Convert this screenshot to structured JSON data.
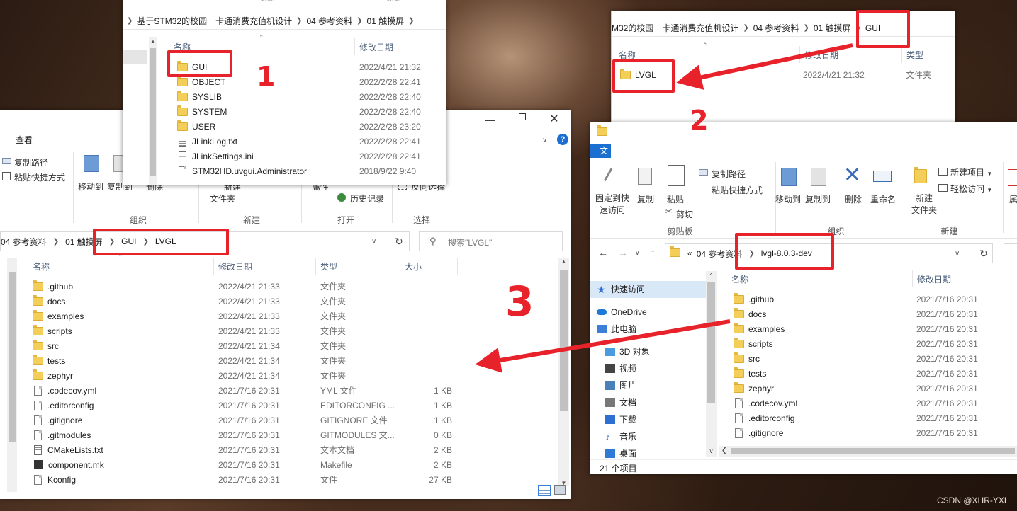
{
  "watermark": "CSDN @XHR-YXL",
  "annotations": {
    "n1": "1",
    "n2": "2",
    "n3": "3"
  },
  "win_gui_parent": {
    "breadcrumb": [
      "基于STM32的校园一卡通消费充值机设计",
      "04 参考资料",
      "01 触摸屏"
    ],
    "top_partial": [
      "还原",
      "新建"
    ],
    "col_name": "名称",
    "col_date": "修改日期",
    "rows": [
      {
        "name": "GUI",
        "date": "2022/4/21 21:32",
        "icon": "folder-icon"
      },
      {
        "name": "OBJECT",
        "date": "2022/2/28 22:41",
        "icon": "folder-icon"
      },
      {
        "name": "SYSLIB",
        "date": "2022/2/28 22:40",
        "icon": "folder-icon"
      },
      {
        "name": "SYSTEM",
        "date": "2022/2/28 22:40",
        "icon": "folder-icon"
      },
      {
        "name": "USER",
        "date": "2022/2/28 23:20",
        "icon": "folder-icon"
      },
      {
        "name": "JLinkLog.txt",
        "date": "2022/2/28 22:41",
        "icon": "txt-icon"
      },
      {
        "name": "JLinkSettings.ini",
        "date": "2022/2/28 22:41",
        "icon": "ini-icon"
      },
      {
        "name": "STM32HD.uvgui.Administrator",
        "date": "2018/9/22 9:40",
        "icon": "file-icon"
      }
    ]
  },
  "win_gui": {
    "breadcrumb": [
      "M32的校园一卡通消费充值机设计",
      "04 参考资料",
      "01 触摸屏",
      "GUI"
    ],
    "col_name": "名称",
    "col_date": "修改日期",
    "col_type": "类型",
    "rows": [
      {
        "name": "LVGL",
        "date": "2022/4/21 21:32",
        "type": "文件夹"
      }
    ]
  },
  "win_lvgl": {
    "tab_view": "查看",
    "ribbon": {
      "copy_path": "复制路径",
      "paste_shortcut": "粘贴快捷方式",
      "move_to": "移动到",
      "copy_to": "复制到",
      "delete": "删除",
      "new_item_partial": "新建",
      "file_folder": "文件夹",
      "properties": "属性",
      "history": "历史记录",
      "invert_select": "反向选择",
      "grp_organize": "组织",
      "grp_new": "新建",
      "grp_open": "打开",
      "grp_select": "选择"
    },
    "breadcrumb": [
      "04 参考资料",
      "01 触摸屏",
      "GUI",
      "LVGL"
    ],
    "search_placeholder": "搜索\"LVGL\"",
    "col_name": "名称",
    "col_date": "修改日期",
    "col_type": "类型",
    "col_size": "大小",
    "rows": [
      {
        "name": ".github",
        "date": "2022/4/21 21:33",
        "type": "文件夹",
        "size": "",
        "icon": "folder-icon"
      },
      {
        "name": "docs",
        "date": "2022/4/21 21:33",
        "type": "文件夹",
        "size": "",
        "icon": "folder-icon"
      },
      {
        "name": "examples",
        "date": "2022/4/21 21:33",
        "type": "文件夹",
        "size": "",
        "icon": "folder-icon"
      },
      {
        "name": "scripts",
        "date": "2022/4/21 21:33",
        "type": "文件夹",
        "size": "",
        "icon": "folder-icon"
      },
      {
        "name": "src",
        "date": "2022/4/21 21:34",
        "type": "文件夹",
        "size": "",
        "icon": "folder-icon"
      },
      {
        "name": "tests",
        "date": "2022/4/21 21:34",
        "type": "文件夹",
        "size": "",
        "icon": "folder-icon"
      },
      {
        "name": "zephyr",
        "date": "2022/4/21 21:34",
        "type": "文件夹",
        "size": "",
        "icon": "folder-icon"
      },
      {
        "name": ".codecov.yml",
        "date": "2021/7/16 20:31",
        "type": "YML 文件",
        "size": "1 KB",
        "icon": "file-icon"
      },
      {
        "name": ".editorconfig",
        "date": "2021/7/16 20:31",
        "type": "EDITORCONFIG ...",
        "size": "1 KB",
        "icon": "file-icon"
      },
      {
        "name": ".gitignore",
        "date": "2021/7/16 20:31",
        "type": "GITIGNORE 文件",
        "size": "1 KB",
        "icon": "file-icon"
      },
      {
        "name": ".gitmodules",
        "date": "2021/7/16 20:31",
        "type": "GITMODULES 文...",
        "size": "0 KB",
        "icon": "file-icon"
      },
      {
        "name": "CMakeLists.txt",
        "date": "2021/7/16 20:31",
        "type": "文本文档",
        "size": "2 KB",
        "icon": "txt-icon"
      },
      {
        "name": "component.mk",
        "date": "2021/7/16 20:31",
        "type": "Makefile",
        "size": "2 KB",
        "icon": "mk-icon"
      },
      {
        "name": "Kconfig",
        "date": "2021/7/16 20:31",
        "type": "文件",
        "size": "27 KB",
        "icon": "file-icon"
      }
    ]
  },
  "win_src": {
    "tab_partial": "文",
    "ribbon": {
      "pin_quick": "固定到快\n速访问",
      "copy": "复制",
      "paste": "粘贴",
      "copy_path": "复制路径",
      "paste_shortcut": "粘贴快捷方式",
      "cut": "剪切",
      "move_to": "移动到",
      "copy_to": "复制到",
      "delete": "删除",
      "rename": "重命名",
      "new_folder": "新建\n文件夹",
      "new_item": "新建项目",
      "easy_access": "轻松访问",
      "grp_clipboard": "剪贴板",
      "grp_organize": "组织",
      "grp_new": "新建",
      "attr_partial": "属"
    },
    "breadcrumb": [
      "«",
      "04 参考资料",
      "lvgl-8.0.3-dev"
    ],
    "nav": [
      {
        "label": "快速访问",
        "icon": "star-icon"
      },
      {
        "label": "OneDrive",
        "icon": "cloud-icon"
      },
      {
        "label": "此电脑",
        "icon": "pc-icon"
      },
      {
        "label": "3D 对象",
        "icon": "cube-icon"
      },
      {
        "label": "视频",
        "icon": "video-icon"
      },
      {
        "label": "图片",
        "icon": "picture-icon"
      },
      {
        "label": "文档",
        "icon": "document-icon"
      },
      {
        "label": "下载",
        "icon": "download-icon"
      },
      {
        "label": "音乐",
        "icon": "music-icon"
      },
      {
        "label": "桌面",
        "icon": "desktop-icon"
      }
    ],
    "col_name": "名称",
    "col_date": "修改日期",
    "rows": [
      {
        "name": ".github",
        "date": "2021/7/16 20:31",
        "icon": "folder-icon"
      },
      {
        "name": "docs",
        "date": "2021/7/16 20:31",
        "icon": "folder-icon"
      },
      {
        "name": "examples",
        "date": "2021/7/16 20:31",
        "icon": "folder-icon"
      },
      {
        "name": "scripts",
        "date": "2021/7/16 20:31",
        "icon": "folder-icon"
      },
      {
        "name": "src",
        "date": "2021/7/16 20:31",
        "icon": "folder-icon"
      },
      {
        "name": "tests",
        "date": "2021/7/16 20:31",
        "icon": "folder-icon"
      },
      {
        "name": "zephyr",
        "date": "2021/7/16 20:31",
        "icon": "folder-icon"
      },
      {
        "name": ".codecov.yml",
        "date": "2021/7/16 20:31",
        "icon": "file-icon"
      },
      {
        "name": ".editorconfig",
        "date": "2021/7/16 20:31",
        "icon": "file-icon"
      },
      {
        "name": ".gitignore",
        "date": "2021/7/16 20:31",
        "icon": "file-icon"
      }
    ],
    "status": "21 个项目"
  }
}
